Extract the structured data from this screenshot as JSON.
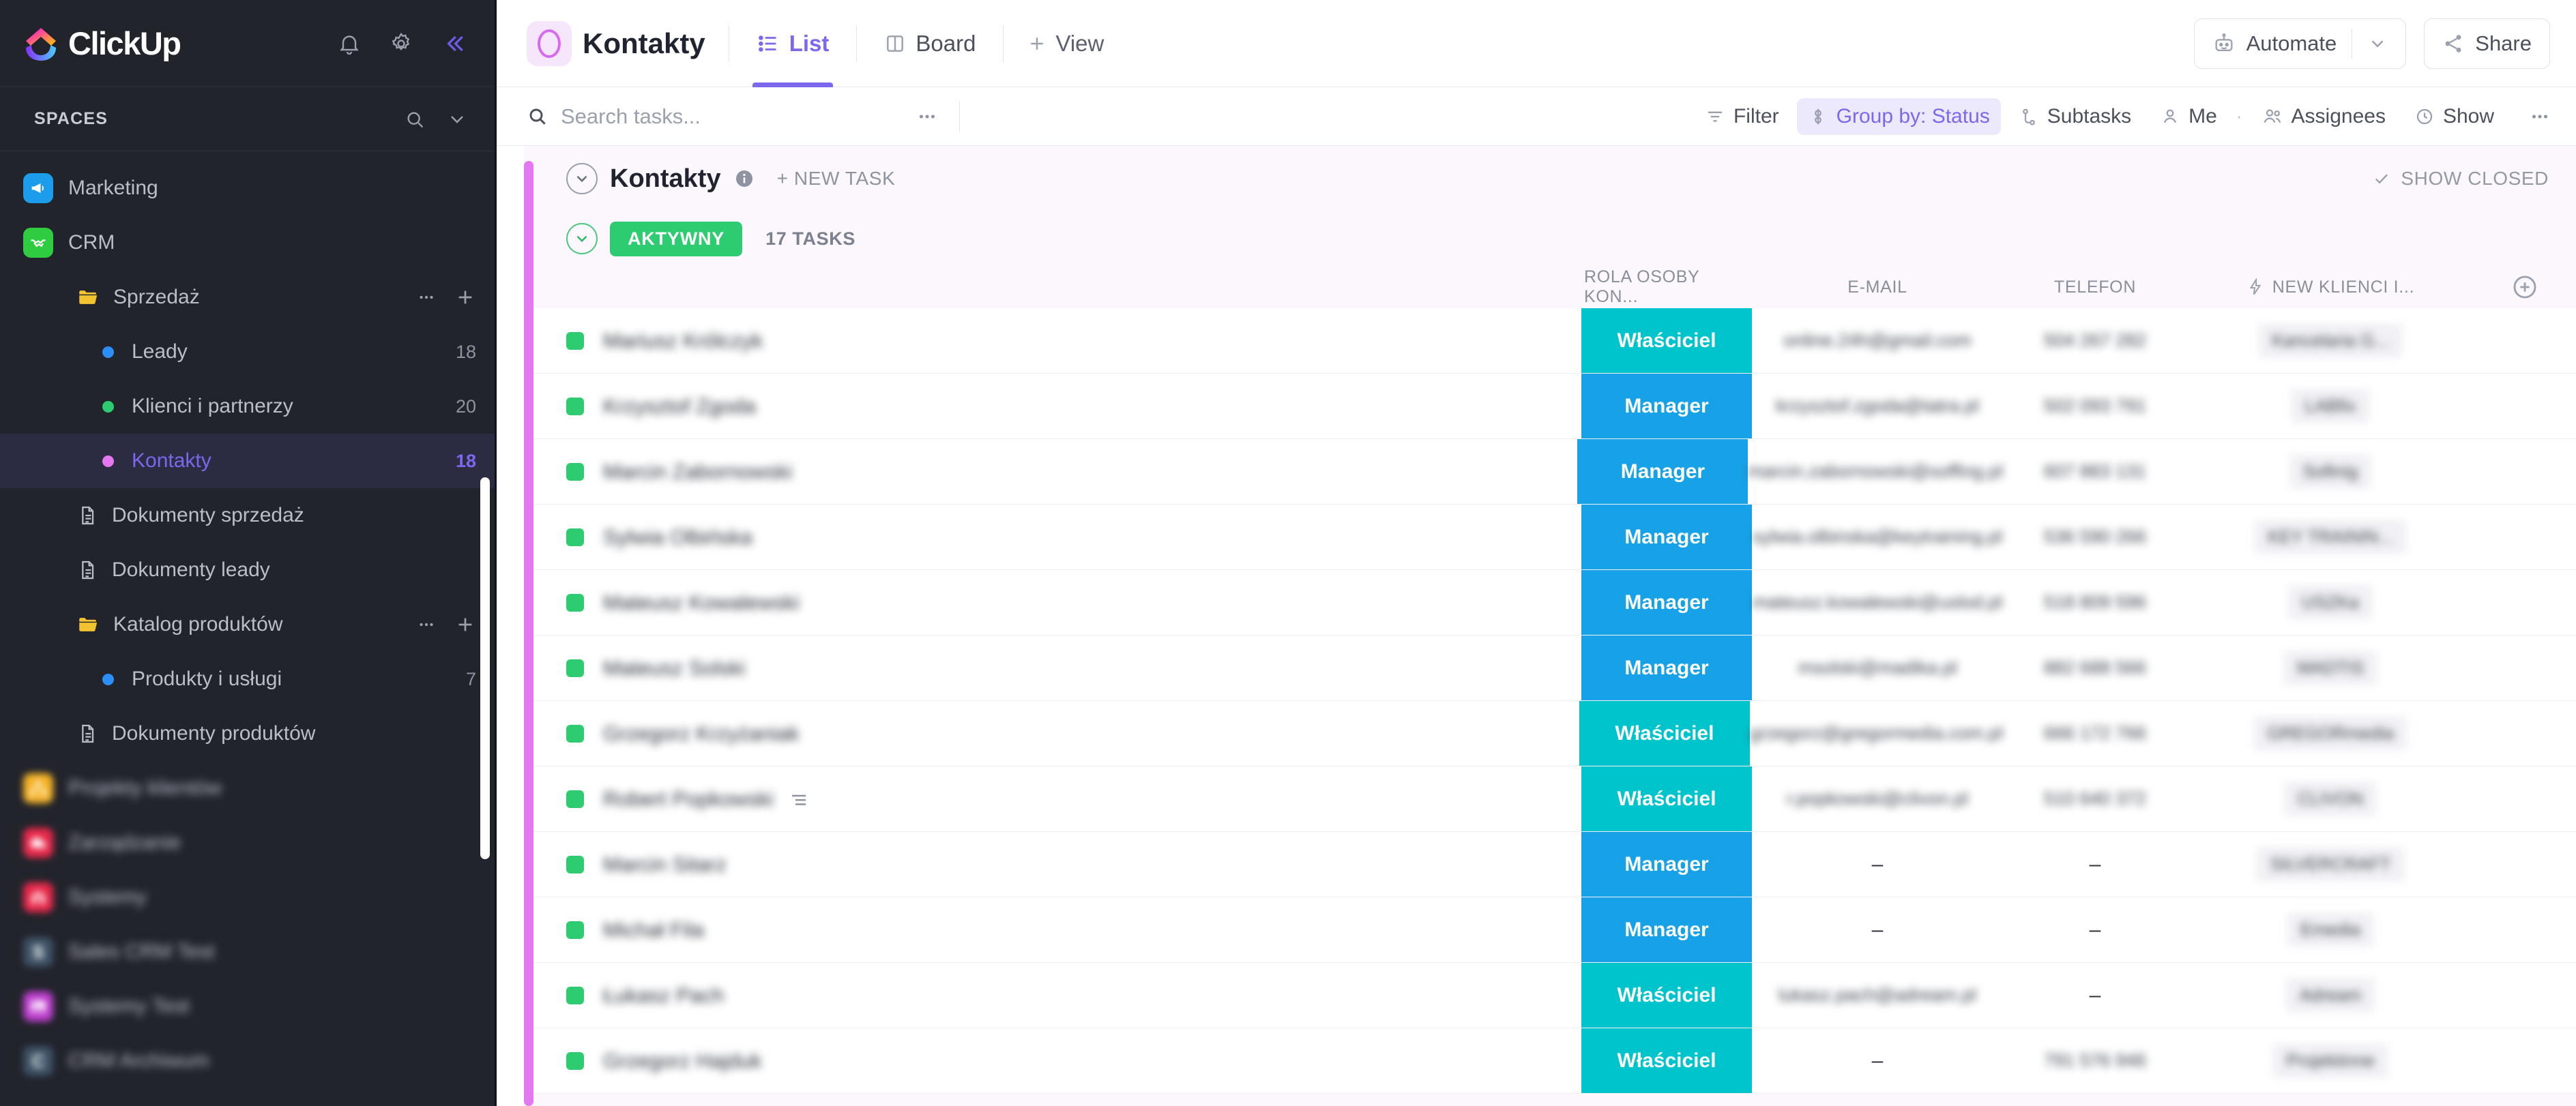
{
  "sidebar": {
    "brand": "ClickUp",
    "top_icons": [
      {
        "name": "bell-icon",
        "label": "Notifications"
      },
      {
        "name": "gear-icon",
        "label": "Settings"
      },
      {
        "name": "collapse-sidebar-icon",
        "label": "Collapse"
      }
    ],
    "spaces_label": "SPACES",
    "spaces_actions": [
      {
        "name": "sidebar-search-icon",
        "label": "Search"
      },
      {
        "name": "chevron-down-icon",
        "label": "Expand"
      }
    ],
    "items": [
      {
        "label": "Marketing",
        "type": "space",
        "icon": "megaphone-icon",
        "color": "#1c9dec",
        "count": "",
        "blurred": false,
        "selected": false
      },
      {
        "label": "CRM",
        "type": "space",
        "icon": "handshake-icon",
        "color": "#2ecc40",
        "count": "",
        "blurred": false,
        "selected": false
      },
      {
        "label": "Sprzedaż",
        "type": "folder",
        "icon": "folder-icon",
        "count": "",
        "actions": [
          "ellipsis-icon",
          "plus-icon"
        ],
        "blurred": false,
        "selected": false
      },
      {
        "label": "Leady",
        "type": "list",
        "icon": "list-dot-icon",
        "dot": "#2c8ef8",
        "count": "18",
        "blurred": false,
        "selected": false
      },
      {
        "label": "Klienci i partnerzy",
        "type": "list",
        "icon": "list-dot-icon",
        "dot": "#2ecc71",
        "count": "20",
        "blurred": false,
        "selected": false
      },
      {
        "label": "Kontakty",
        "type": "list",
        "icon": "list-dot-icon",
        "dot": "#e478f0",
        "count": "18",
        "blurred": false,
        "selected": true
      },
      {
        "label": "Dokumenty sprzedaż",
        "type": "doc",
        "icon": "document-icon",
        "count": "",
        "blurred": false,
        "selected": false
      },
      {
        "label": "Dokumenty leady",
        "type": "doc",
        "icon": "document-icon",
        "count": "",
        "blurred": false,
        "selected": false
      },
      {
        "label": "Katalog produktów",
        "type": "folder",
        "icon": "folder-icon",
        "count": "",
        "actions": [
          "ellipsis-icon",
          "plus-icon"
        ],
        "blurred": false,
        "selected": false
      },
      {
        "label": "Produkty i usługi",
        "type": "list",
        "icon": "list-dot-icon",
        "dot": "#2c8ef8",
        "count": "7",
        "blurred": false,
        "selected": false
      },
      {
        "label": "Dokumenty produktów",
        "type": "doc",
        "icon": "document-icon",
        "count": "",
        "blurred": false,
        "selected": false
      },
      {
        "label": "Projekty klientów",
        "type": "space",
        "icon": "sitemap-icon",
        "color": "#f5b327",
        "count": "",
        "blurred": true,
        "selected": false
      },
      {
        "label": "Zarządzanie",
        "type": "space",
        "icon": "briefcase-clock-icon",
        "color": "#e8294a",
        "count": "",
        "blurred": true,
        "selected": false
      },
      {
        "label": "Systemy",
        "type": "space",
        "icon": "gate-icon",
        "color": "#e8294a",
        "count": "",
        "blurred": true,
        "selected": false
      },
      {
        "label": "Sales CRM Test",
        "type": "space",
        "icon": "letter-s-icon",
        "color": "#3e5265",
        "count": "",
        "blurred": true,
        "selected": false
      },
      {
        "label": "Systemy Test",
        "type": "space",
        "icon": "image-icon",
        "color": "#bf3fd0",
        "count": "",
        "blurred": true,
        "selected": false
      },
      {
        "label": "CRM Archiwum",
        "type": "space",
        "icon": "letter-c-icon",
        "color": "#3e5265",
        "count": "",
        "blurred": true,
        "selected": false
      }
    ]
  },
  "topbar": {
    "list_title": "Kontakty",
    "tabs": [
      {
        "label": "List",
        "icon": "list-view-icon",
        "active": true
      },
      {
        "label": "Board",
        "icon": "board-view-icon",
        "active": false
      }
    ],
    "add_view": "View",
    "automate_label": "Automate",
    "share_label": "Share"
  },
  "filterbar": {
    "search_placeholder": "Search tasks...",
    "search_value": "",
    "items": [
      {
        "label": "Filter",
        "icon": "filter-icon",
        "active": false
      },
      {
        "label": "Group by: Status",
        "icon": "group-by-icon",
        "active": true
      },
      {
        "label": "Subtasks",
        "icon": "subtasks-icon",
        "active": false
      },
      {
        "label": "Me",
        "icon": "person-icon",
        "active": false
      },
      {
        "label": "Assignees",
        "icon": "people-icon",
        "active": false
      },
      {
        "label": "Show",
        "icon": "eye-icon",
        "active": false
      }
    ],
    "overflow": "…"
  },
  "list_header": {
    "title": "Kontakty",
    "new_task": "+ NEW TASK",
    "show_closed": "SHOW CLOSED"
  },
  "group": {
    "status": "AKTYWNY",
    "status_color": "#2ecc71",
    "task_count": "17 TASKS"
  },
  "table": {
    "columns": [
      {
        "key": "name",
        "label": ""
      },
      {
        "key": "role",
        "label": "ROLA OSOBY KON..."
      },
      {
        "key": "email",
        "label": "E-MAIL"
      },
      {
        "key": "phone",
        "label": "TELEFON"
      },
      {
        "key": "new_klienci",
        "label": "NEW KLIENCI I...",
        "icon": "lightning-link-icon"
      }
    ],
    "role_colors": {
      "Właściciel": "#00c4cc",
      "Manager": "#17a2e8"
    },
    "rows": [
      {
        "name": "Mariusz Królczyk",
        "status_color": "#2ecc71",
        "role": "Właściciel",
        "email": "online.24h@gmail.com",
        "phone": "504 267 282",
        "new_klienci": "Kancelaria G...",
        "blurred": true,
        "subtask_icon": false
      },
      {
        "name": "Krzysztof Zgoda",
        "status_color": "#2ecc71",
        "role": "Manager",
        "email": "krzysztof.zgoda@tatra.pl",
        "phone": "502 093 791",
        "new_klienci": "LABfix",
        "blurred": true,
        "subtask_icon": false
      },
      {
        "name": "Marcin Zabornowski",
        "status_color": "#2ecc71",
        "role": "Manager",
        "email": "marcin.zabornowski@soffing.pl",
        "phone": "607 883 131",
        "new_klienci": "Softnig",
        "blurred": true,
        "subtask_icon": false
      },
      {
        "name": "Sylwia Olbińska",
        "status_color": "#2ecc71",
        "role": "Manager",
        "email": "sylwia.olbinska@keytraining.pl",
        "phone": "536 590 266",
        "new_klienci": "KEY TRAININ...",
        "blurred": true,
        "subtask_icon": false
      },
      {
        "name": "Mateusz Kowalewski",
        "status_color": "#2ecc71",
        "role": "Manager",
        "email": "mateusz.kowalewski@uslod.pl",
        "phone": "518 809 596",
        "new_klienci": "USZKa",
        "blurred": true,
        "subtask_icon": false
      },
      {
        "name": "Mateusz Solski",
        "status_color": "#2ecc71",
        "role": "Manager",
        "email": "msolski@madika.pl",
        "phone": "882 688 566",
        "new_klienci": "MADTIS",
        "blurred": true,
        "subtask_icon": false
      },
      {
        "name": "Grzegorz Krzyżaniak",
        "status_color": "#2ecc71",
        "role": "Właściciel",
        "email": "grzegorz@gregormedia.com.pl",
        "phone": "666 172 766",
        "new_klienci": "GREGORmedia",
        "blurred": true,
        "subtask_icon": false
      },
      {
        "name": "Robert Popkowski",
        "status_color": "#2ecc71",
        "role": "Właściciel",
        "email": "r.popkowski@clivon.pl",
        "phone": "510 640 372",
        "new_klienci": "CLIVON",
        "blurred": true,
        "subtask_icon": true
      },
      {
        "name": "Marcin Sitarz",
        "status_color": "#2ecc71",
        "role": "Manager",
        "email": "–",
        "phone": "–",
        "new_klienci": "SILVERCRAFT",
        "blurred": true,
        "subtask_icon": false
      },
      {
        "name": "Michał Fila",
        "status_color": "#2ecc71",
        "role": "Manager",
        "email": "–",
        "phone": "–",
        "new_klienci": "Emedia",
        "blurred": true,
        "subtask_icon": false
      },
      {
        "name": "Łukasz Pach",
        "status_color": "#2ecc71",
        "role": "Właściciel",
        "email": "lukasz.pach@adream.pl",
        "phone": "–",
        "new_klienci": "Adream",
        "blurred": true,
        "subtask_icon": false
      },
      {
        "name": "Grzegorz Hajduk",
        "status_color": "#2ecc71",
        "role": "Właściciel",
        "email": "–",
        "phone": "791 576 946",
        "new_klienci": "Projektinne",
        "blurred": true,
        "subtask_icon": false
      }
    ],
    "add_column_icon": "plus-circle-icon"
  }
}
